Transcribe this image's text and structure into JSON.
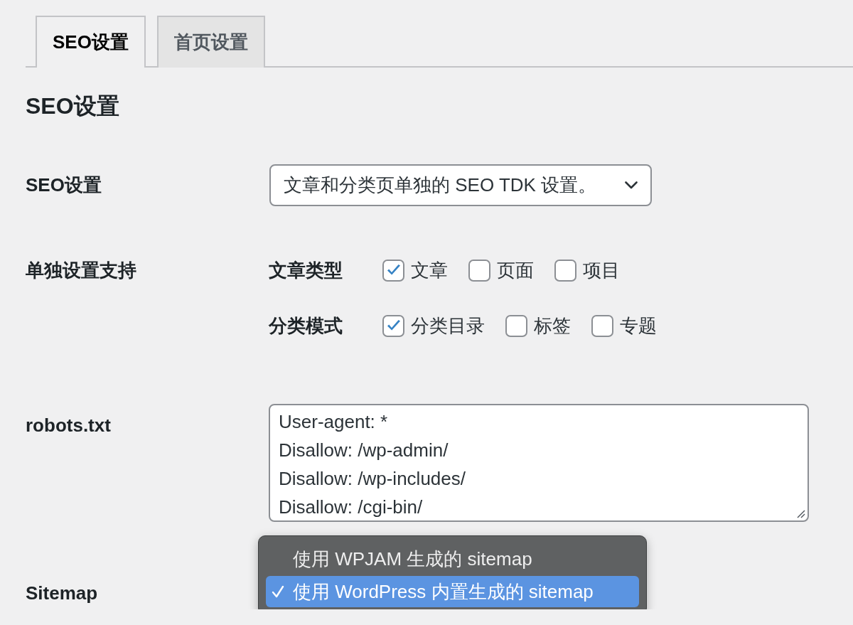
{
  "tabs": [
    {
      "label": "SEO设置",
      "selected": true
    },
    {
      "label": "首页设置",
      "selected": false
    }
  ],
  "heading": "SEO设置",
  "fields": [
    {
      "kind": "select",
      "label": "SEO设置",
      "value": "文章和分类页单独的 SEO TDK 设置。"
    },
    {
      "kind": "checkbox_groups",
      "label": "单独设置支持",
      "groups": [
        {
          "label": "文章类型",
          "options": [
            {
              "label": "文章",
              "checked": true
            },
            {
              "label": "页面",
              "checked": false
            },
            {
              "label": "项目",
              "checked": false
            }
          ]
        },
        {
          "label": "分类模式",
          "options": [
            {
              "label": "分类目录",
              "checked": true
            },
            {
              "label": "标签",
              "checked": false
            },
            {
              "label": "专题",
              "checked": false
            }
          ]
        }
      ]
    },
    {
      "kind": "textarea",
      "label": "robots.txt",
      "value": "User-agent: *\nDisallow: /wp-admin/\nDisallow: /wp-includes/\nDisallow: /cgi-bin/"
    },
    {
      "kind": "dropdown",
      "label": "Sitemap",
      "options": [
        {
          "label": "使用 WPJAM 生成的 sitemap",
          "selected": false
        },
        {
          "label": "使用 WordPress 内置生成的 sitemap",
          "selected": true
        }
      ]
    }
  ]
}
